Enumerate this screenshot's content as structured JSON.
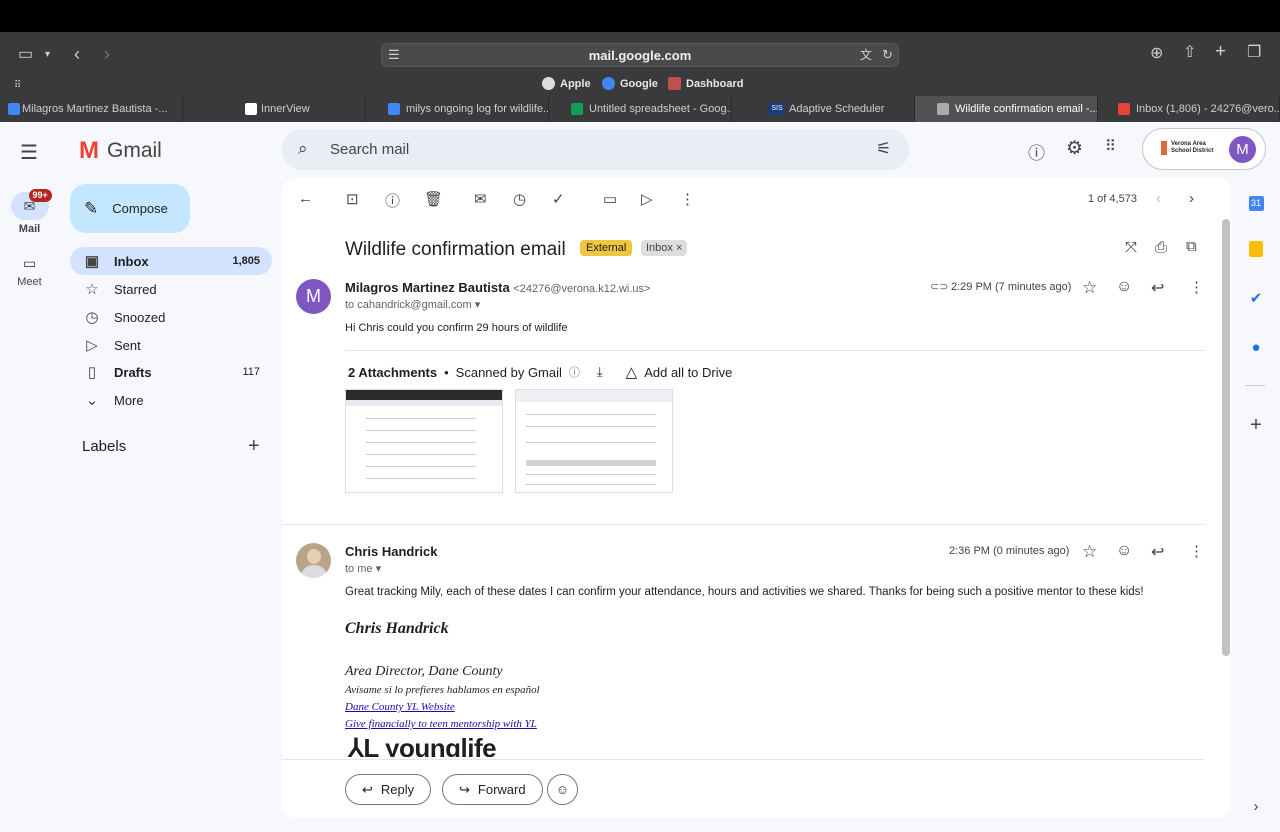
{
  "browser": {
    "url": "mail.google.com",
    "favorites": [
      "Apple",
      "Google",
      "Dashboard"
    ],
    "tabs": [
      "Milagros Martinez Bautista -...",
      "InnerView",
      "milys ongoing log for wildlife...",
      "Untitled spreadsheet - Goog...",
      "Adaptive Scheduler",
      "Wildlife confirmation email -...",
      "Inbox (1,806) - 24276@vero..."
    ],
    "sis_label": "SIS"
  },
  "gmail": {
    "brand": "Gmail",
    "mail_badge": "99+",
    "rail": {
      "mail": "Mail",
      "meet": "Meet"
    },
    "compose": "Compose",
    "nav": [
      {
        "label": "Inbox",
        "count": "1,805",
        "icon": "inbox-icon"
      },
      {
        "label": "Starred",
        "count": "",
        "icon": "star-icon"
      },
      {
        "label": "Snoozed",
        "count": "",
        "icon": "clock-icon"
      },
      {
        "label": "Sent",
        "count": "",
        "icon": "send-icon"
      },
      {
        "label": "Drafts",
        "count": "117",
        "icon": "draft-icon"
      },
      {
        "label": "More",
        "count": "",
        "icon": "chevron-down-icon"
      }
    ],
    "labels_heading": "Labels",
    "search_placeholder": "Search mail",
    "account_initial": "M",
    "district": "Verona Area School District"
  },
  "thread": {
    "pager": "1 of 4,573",
    "subject": "Wildlife confirmation email",
    "badge_external": "External",
    "badge_inbox": "Inbox ×",
    "msg1": {
      "avatar": "M",
      "sender": "Milagros Martinez Bautista",
      "email": "<24276@verona.k12.wi.us>",
      "to": "to cahandrick@gmail.com",
      "time": "2:29 PM (7 minutes ago)",
      "body": "Hi Chris could you confirm 29 hours of wildlife",
      "attachments_title": "2 Attachments",
      "scanned": "Scanned by Gmail",
      "add_drive": "Add all to Drive"
    },
    "msg2": {
      "sender": "Chris Handrick",
      "to": "to me",
      "time": "2:36 PM (0 minutes ago)",
      "body": "Great tracking Mily, each of these dates I can confirm your attendance, hours and activities we shared. Thanks for being such a positive mentor to these kids!",
      "sig_name": "Chris Handrick",
      "sig_title": "Area Director, Dane County",
      "sig_spanish": "Avísame si lo prefieres hablamos en español",
      "sig_link1": "Dane County YL Website",
      "sig_link2": "Give financially to teen mentorship with YL",
      "logo_text": "younglife"
    },
    "reply": "Reply",
    "forward": "Forward"
  }
}
